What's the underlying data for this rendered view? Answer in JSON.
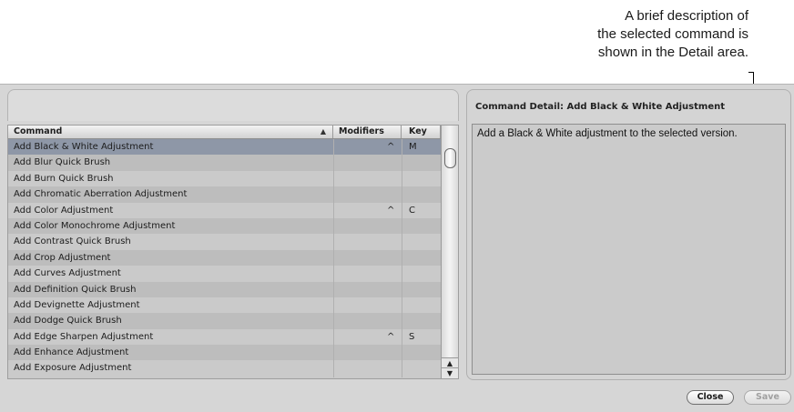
{
  "callout": {
    "line1": "A brief description of",
    "line2": "the selected command is",
    "line3": "shown in the Detail area."
  },
  "list": {
    "headers": {
      "command": "Command",
      "modifiers": "Modifiers",
      "key": "Key"
    },
    "sort_arrow": "▲",
    "rows": [
      {
        "command": "Add Black & White Adjustment",
        "modifiers": "^",
        "key": "M",
        "selected": true
      },
      {
        "command": "Add Blur Quick Brush",
        "modifiers": "",
        "key": ""
      },
      {
        "command": "Add Burn Quick Brush",
        "modifiers": "",
        "key": ""
      },
      {
        "command": "Add Chromatic Aberration Adjustment",
        "modifiers": "",
        "key": ""
      },
      {
        "command": "Add Color Adjustment",
        "modifiers": "^",
        "key": "C"
      },
      {
        "command": "Add Color Monochrome Adjustment",
        "modifiers": "",
        "key": ""
      },
      {
        "command": "Add Contrast Quick Brush",
        "modifiers": "",
        "key": ""
      },
      {
        "command": "Add Crop Adjustment",
        "modifiers": "",
        "key": ""
      },
      {
        "command": "Add Curves Adjustment",
        "modifiers": "",
        "key": ""
      },
      {
        "command": "Add Definition Quick Brush",
        "modifiers": "",
        "key": ""
      },
      {
        "command": "Add Devignette Adjustment",
        "modifiers": "",
        "key": ""
      },
      {
        "command": "Add Dodge Quick Brush",
        "modifiers": "",
        "key": ""
      },
      {
        "command": "Add Edge Sharpen Adjustment",
        "modifiers": "^",
        "key": "S"
      },
      {
        "command": "Add Enhance Adjustment",
        "modifiers": "",
        "key": ""
      },
      {
        "command": "Add Exposure Adjustment",
        "modifiers": "",
        "key": ""
      }
    ]
  },
  "detail": {
    "title": "Command Detail: Add Black & White Adjustment",
    "text": "Add a Black & White adjustment to the selected version."
  },
  "buttons": {
    "close": "Close",
    "save": "Save"
  }
}
